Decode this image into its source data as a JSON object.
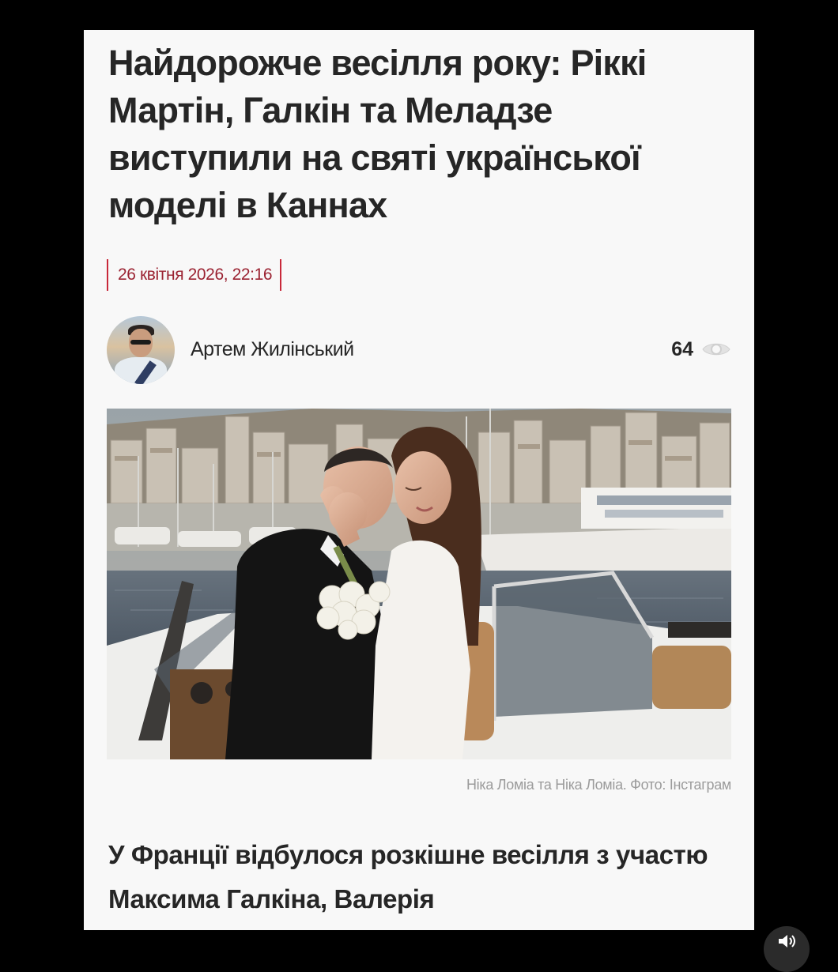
{
  "article": {
    "title": "Найдорожче весілля року: Ріккі Мартін, Галкін та Меладзе виступили на святі української моделі в Каннах",
    "date": "26 квітня 2026, 22:16",
    "author": {
      "name": "Артем Жилінський",
      "avatar_icon": "avatar-photo"
    },
    "views": {
      "count": "64",
      "icon": "eye-icon"
    },
    "photo": {
      "subject": "wedding-couple-photo"
    },
    "caption": "Ніка Ломіа та Ніка Ломіа. Фото: Інстаграм",
    "lead": "У Франції відбулося розкішне весілля з участю Максима Галкіна, Валерія"
  },
  "player": {
    "sound_icon": "speaker-icon"
  },
  "colors": {
    "accent": "#c8283a",
    "date_text": "#9b2332",
    "text": "#262626",
    "caption": "#9b9b9b",
    "card_background": "#f8f8f8"
  }
}
